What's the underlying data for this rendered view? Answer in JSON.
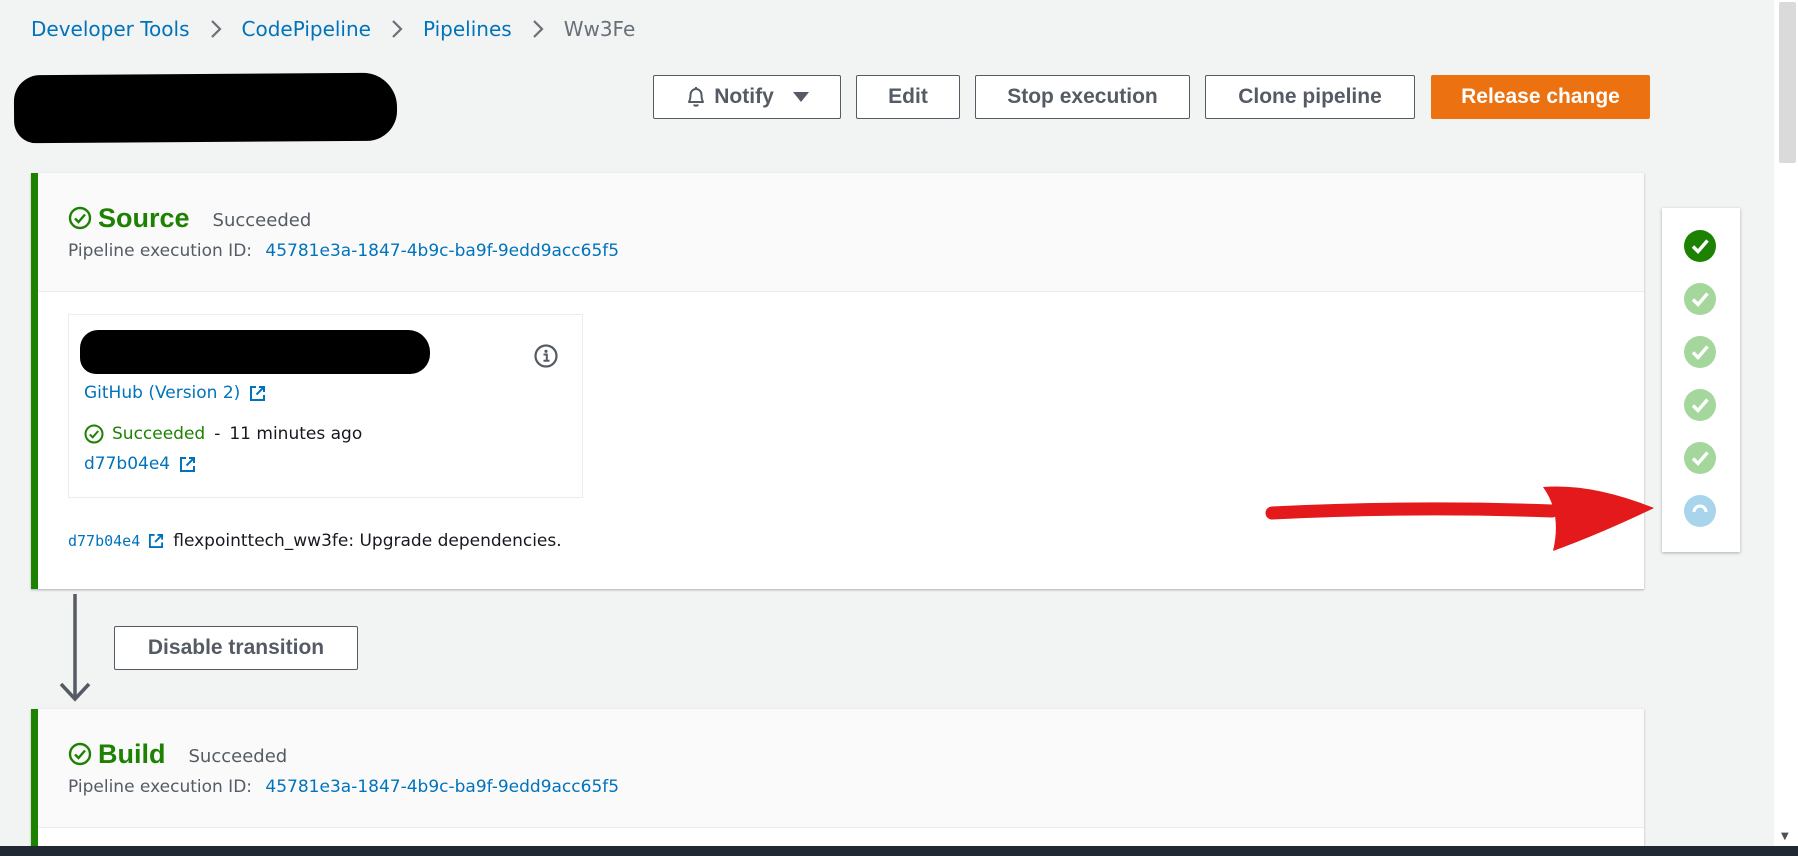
{
  "breadcrumb": {
    "items": [
      "Developer Tools",
      "CodePipeline",
      "Pipelines"
    ],
    "current": "Ww3Fe"
  },
  "toolbar": {
    "notify_label": "Notify",
    "edit_label": "Edit",
    "stop_label": "Stop execution",
    "clone_label": "Clone pipeline",
    "release_label": "Release change"
  },
  "stages": {
    "source": {
      "title": "Source",
      "status": "Succeeded",
      "exec_label": "Pipeline execution ID:",
      "exec_id": "45781e3a-1847-4b9c-ba9f-9edd9acc65f5",
      "action": {
        "provider": "GitHub (Version 2)",
        "status": "Succeeded",
        "separator": "-",
        "time": "11 minutes ago",
        "commit": "d77b04e4"
      },
      "commit_row": {
        "commit": "d77b04e4",
        "message": "flexpointtech_ww3fe: Upgrade dependencies."
      }
    },
    "build": {
      "title": "Build",
      "status": "Succeeded",
      "exec_label": "Pipeline execution ID:",
      "exec_id": "45781e3a-1847-4b9c-ba9f-9edd9acc65f5"
    }
  },
  "transition": {
    "disable_label": "Disable transition"
  },
  "colors": {
    "success": "#1d8102",
    "link": "#0073bb",
    "primary": "#ec7211",
    "in_progress": "#a8d4ec",
    "annotation": "#e3191b"
  }
}
